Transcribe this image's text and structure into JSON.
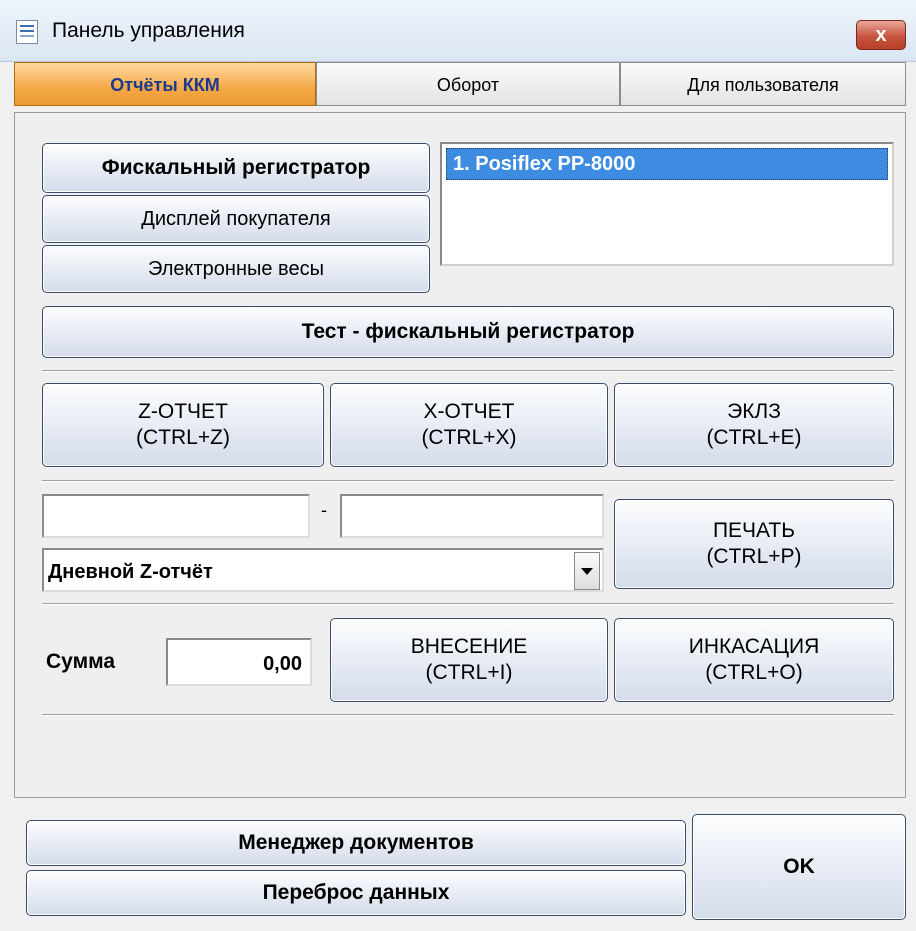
{
  "window": {
    "title": "Панель управления",
    "close_label": "x"
  },
  "tabs": [
    {
      "label": "Отчёты ККМ",
      "active": true
    },
    {
      "label": "Оборот",
      "active": false
    },
    {
      "label": "Для пользователя",
      "active": false
    }
  ],
  "device_buttons": {
    "fiscal": "Фискальный регистратор",
    "display": "Дисплей покупателя",
    "scales": "Электронные весы"
  },
  "device_list": {
    "items": [
      "1.  Posiflex PP-8000"
    ],
    "selected_index": 0
  },
  "test_button": "Тест - фискальный регистратор",
  "report_buttons": {
    "z": {
      "line1": "Z-ОТЧЕТ",
      "line2": "(CTRL+Z)"
    },
    "x": {
      "line1": "X-ОТЧЕТ",
      "line2": "(CTRL+X)"
    },
    "eklz": {
      "line1": "ЭКЛЗ",
      "line2": "(CTRL+E)"
    }
  },
  "range": {
    "from_value": "",
    "separator": "-",
    "to_value": ""
  },
  "report_type_select": {
    "value": "Дневной Z-отчёт"
  },
  "print_button": {
    "line1": "ПЕЧАТЬ",
    "line2": "(CTRL+P)"
  },
  "sum": {
    "label": "Сумма",
    "value": "0,00"
  },
  "cash_in_button": {
    "line1": "ВНЕСЕНИЕ",
    "line2": "(CTRL+I)"
  },
  "cash_out_button": {
    "line1": "ИНКАСАЦИЯ",
    "line2": "(CTRL+O)"
  },
  "footer": {
    "doc_manager": "Менеджер документов",
    "data_transfer": "Переброс данных",
    "ok": "OK"
  },
  "colors": {
    "active_tab": "#f5a947",
    "selection": "#3d8ce2",
    "close_button": "#c8553f"
  }
}
